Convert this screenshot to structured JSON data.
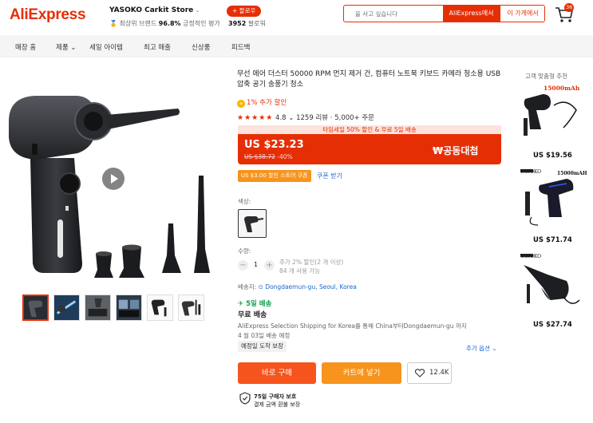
{
  "header": {
    "logo": "AliExpress",
    "store_name": "YASOKO Carkit Store",
    "store_badge": "최상위 브랜드",
    "positive_rate": "96.8%",
    "positive_label": "긍정적인 평가",
    "follow_label": "+ 팔로우",
    "followers_count": "3952",
    "followers_label": "팔로워",
    "search_placeholder": "을 사고 싶습니다",
    "search_all_label": "AliExpress에서",
    "search_store_label": "이 가게에서",
    "cart_count": "36",
    "accent_color": "#e62e04"
  },
  "nav": {
    "items": [
      "매장 홈",
      "제품",
      "세일 아이템",
      "최고 매출",
      "신상품",
      "피드백"
    ]
  },
  "product": {
    "title": "무선 에어 더스터 50000 RPM 먼지 제거 건, 컴퓨터 노트북 키보드 카메라 청소용 USB 압축 공기 송풍기 청소",
    "coin_text": "1% 추가 할인",
    "rating": "4.8",
    "reviews": "1259 리뷰",
    "orders": "5,000+ 주문",
    "sale_banner": "타임세일 50% 할인 & 무료 5일 배송",
    "price": "US $23.23",
    "old_price": "US $38.72",
    "discount": "-40%",
    "big_save": "₩공동대첩",
    "coupon": "US $3.00 할인 스토어 쿠폰",
    "coupon_link": "쿠폰 받기",
    "color_label": "색상:",
    "quantity_label": "수량:",
    "quantity_value": "1",
    "qty_note_1": "추가 2% 할인(2 개 이상)",
    "qty_note_2": "84 개 사용 가능",
    "ship_to_label": "배송지:",
    "ship_to_value": "Dongdaemun-gu, Seoul, Korea",
    "delivery_fast": "5일 배송",
    "free_shipping": "무료 배송",
    "ship_desc": "AliExpress Selection Shipping for Korea를 통해 China부터Dongdaemun-gu 까지 4 월 03일 배송 예정",
    "guarantee": "예정일 도착 보장",
    "more_options": "추가 옵션",
    "buy_now": "바로 구매",
    "add_cart": "카트에 넣기",
    "wishlist_count": "12.4K",
    "protection_1": "75일 구매자 보호",
    "protection_2": "결제 금액 환불 보장"
  },
  "recommendations": {
    "title": "고객 맞춤형 추천",
    "items": [
      {
        "tag": "15000mAh",
        "price": "US $19.56"
      },
      {
        "tag": "15000mAH",
        "price": "US $71.74"
      },
      {
        "tag": "",
        "price": "US $27.74"
      }
    ]
  }
}
